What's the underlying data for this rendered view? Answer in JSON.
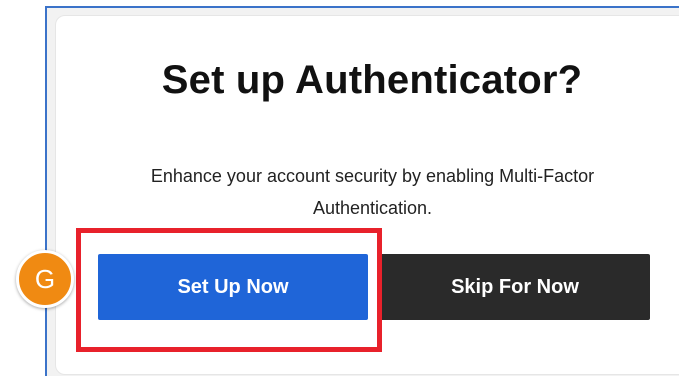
{
  "dialog": {
    "title": "Set up Authenticator?",
    "description": "Enhance your account security by enabling Multi-Factor Authentication.",
    "primary_button_label": "Set Up Now",
    "secondary_button_label": "Skip For Now"
  },
  "annotation": {
    "step_marker_label": "G"
  },
  "colors": {
    "primary_button": "#1f65d8",
    "secondary_button": "#2a2a2a",
    "highlight_border": "#e8212b",
    "step_marker": "#f08a12",
    "window_border": "#3b73c9"
  }
}
